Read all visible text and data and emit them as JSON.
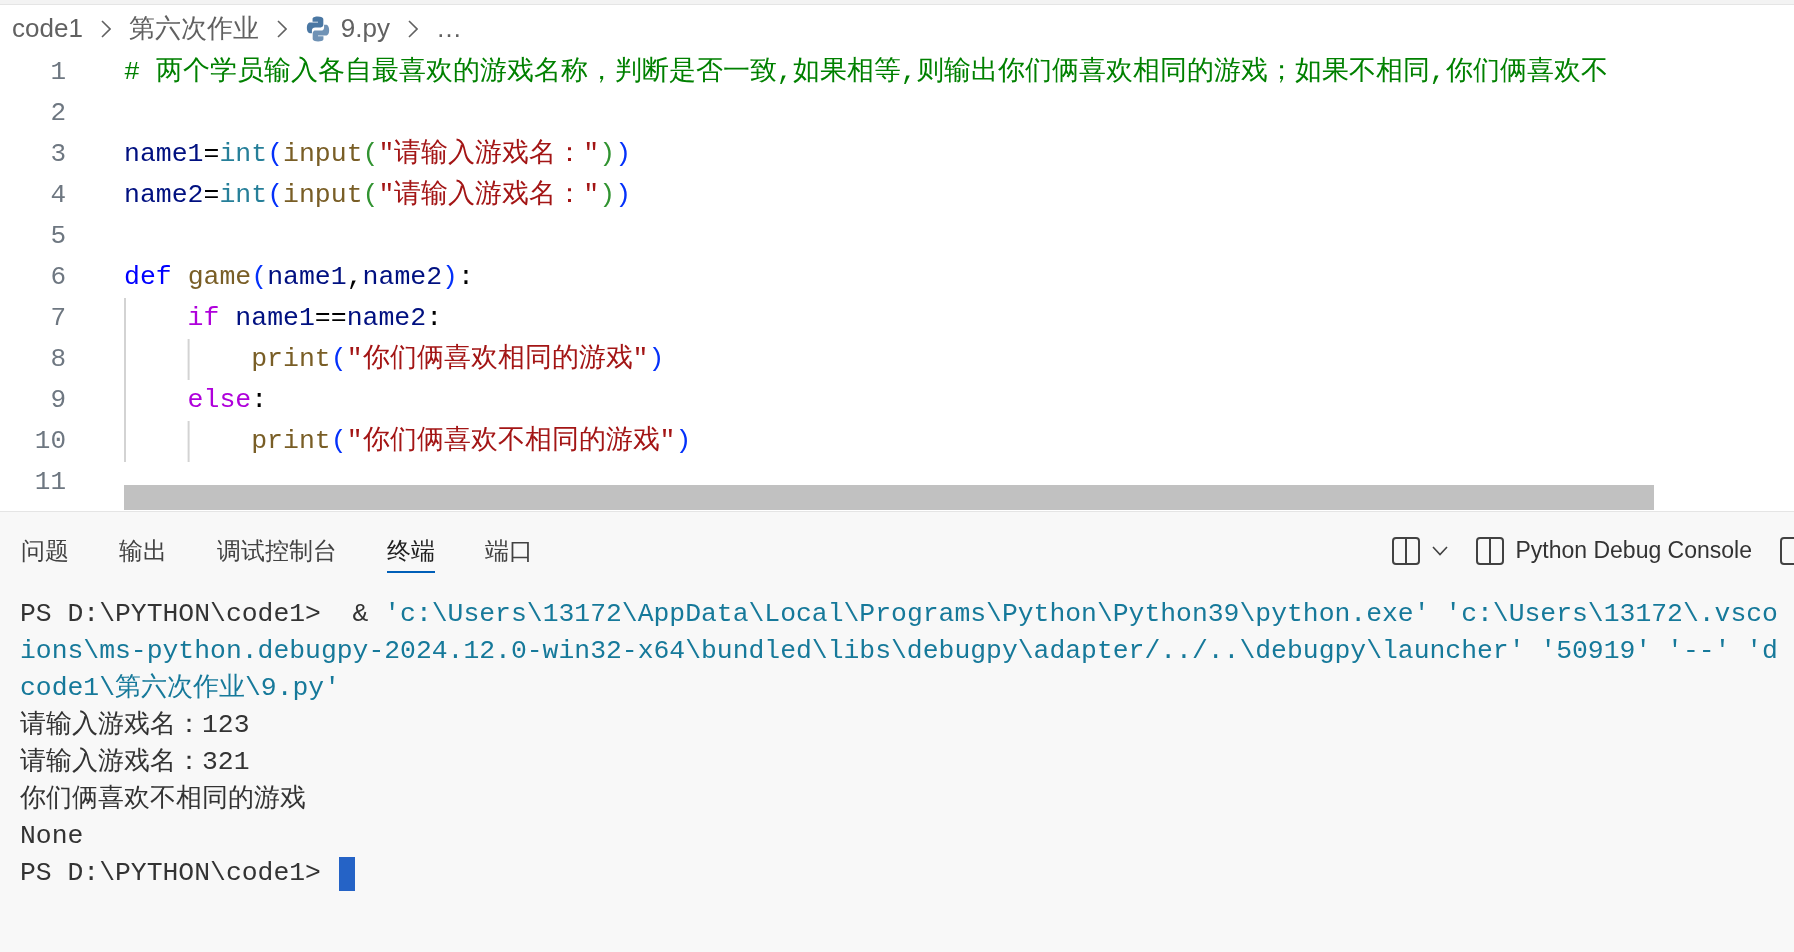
{
  "breadcrumb": {
    "items": [
      {
        "kind": "folder",
        "label": "code1"
      },
      {
        "kind": "folder",
        "label": "第六次作业"
      },
      {
        "kind": "file",
        "label": "9.py"
      },
      {
        "kind": "more",
        "label": "…"
      }
    ]
  },
  "editor": {
    "lines": [
      {
        "number": "1",
        "tokens": [
          {
            "kind": "comment",
            "text": "# 两个学员输入各自最喜欢的游戏名称，判断是否一致,如果相等,则输出你们俩喜欢相同的游戏；如果不相同,你们俩喜欢不"
          }
        ]
      },
      {
        "number": "2"
      },
      {
        "number": "3",
        "tokens": [
          {
            "kind": "variable",
            "text": "name1"
          },
          {
            "kind": "plain",
            "text": "="
          },
          {
            "kind": "type",
            "text": "int"
          },
          {
            "kind": "bracket",
            "text": "("
          },
          {
            "kind": "function",
            "text": "input"
          },
          {
            "kind": "nestedbracket",
            "text": "("
          },
          {
            "kind": "string",
            "text": "\"请输入游戏名：\""
          },
          {
            "kind": "nestedbracket",
            "text": ")"
          },
          {
            "kind": "bracket",
            "text": ")"
          }
        ]
      },
      {
        "number": "4",
        "tokens": [
          {
            "kind": "variable",
            "text": "name2"
          },
          {
            "kind": "plain",
            "text": "="
          },
          {
            "kind": "type",
            "text": "int"
          },
          {
            "kind": "bracket",
            "text": "("
          },
          {
            "kind": "function",
            "text": "input"
          },
          {
            "kind": "nestedbracket",
            "text": "("
          },
          {
            "kind": "string",
            "text": "\"请输入游戏名：\""
          },
          {
            "kind": "nestedbracket",
            "text": ")"
          },
          {
            "kind": "bracket",
            "text": ")"
          }
        ]
      },
      {
        "number": "5"
      },
      {
        "number": "6",
        "tokens": [
          {
            "kind": "keyword",
            "text": "def "
          },
          {
            "kind": "function",
            "text": "game"
          },
          {
            "kind": "bracket",
            "text": "("
          },
          {
            "kind": "variable",
            "text": "name1"
          },
          {
            "kind": "plain",
            "text": ","
          },
          {
            "kind": "variable",
            "text": "name2"
          },
          {
            "kind": "bracket",
            "text": ")"
          },
          {
            "kind": "plain",
            "text": ":"
          }
        ],
        "children": [
          {
            "number": "7",
            "tokens": [
              {
                "kind": "control",
                "text": "if "
              },
              {
                "kind": "variable",
                "text": "name1"
              },
              {
                "kind": "plain",
                "text": "=="
              },
              {
                "kind": "variable",
                "text": "name2"
              },
              {
                "kind": "plain",
                "text": ":"
              }
            ],
            "children": [
              {
                "number": "8",
                "tokens": [
                  {
                    "kind": "function",
                    "text": "print"
                  },
                  {
                    "kind": "bracket",
                    "text": "("
                  },
                  {
                    "kind": "string",
                    "text": "\"你们俩喜欢相同的游戏\""
                  },
                  {
                    "kind": "bracket",
                    "text": ")"
                  }
                ]
              }
            ]
          },
          {
            "number": "9",
            "tokens": [
              {
                "kind": "control",
                "text": "else"
              },
              {
                "kind": "plain",
                "text": ":"
              }
            ],
            "children": [
              {
                "number": "10",
                "tokens": [
                  {
                    "kind": "function",
                    "text": "print"
                  },
                  {
                    "kind": "bracket",
                    "text": "("
                  },
                  {
                    "kind": "string",
                    "text": "\"你们俩喜欢不相同的游戏\""
                  },
                  {
                    "kind": "bracket",
                    "text": ")"
                  }
                ]
              }
            ]
          }
        ]
      },
      {
        "number": "11"
      }
    ]
  },
  "panel": {
    "tabs": [
      {
        "label": "问题",
        "selected": false
      },
      {
        "label": "输出",
        "selected": false
      },
      {
        "label": "调试控制台",
        "selected": false
      },
      {
        "label": "终端",
        "selected": true
      },
      {
        "label": "端口",
        "selected": false
      }
    ],
    "terminal_tab": {
      "label": "Python Debug Console"
    },
    "terminal": {
      "lines": [
        {
          "cursor": false,
          "segments": [
            {
              "kind": "plain",
              "text": "PS D:\\PYTHON\\code1>  & "
            },
            {
              "kind": "string",
              "text": "'c:\\Users\\13172\\AppData\\Local\\Programs\\Python\\Python39\\python.exe' 'c:\\Users\\13172\\.vsco"
            }
          ]
        },
        {
          "cursor": false,
          "segments": [
            {
              "kind": "string",
              "text": "ions\\ms-python.debugpy-2024.12.0-win32-x64\\bundled\\libs\\debugpy\\adapter/../..\\debugpy\\launcher' '50919' '--' 'd"
            }
          ]
        },
        {
          "cursor": false,
          "segments": [
            {
              "kind": "string",
              "text": "code1\\第六次作业\\9.py'"
            }
          ]
        },
        {
          "cursor": false,
          "segments": [
            {
              "kind": "plain",
              "text": "请输入游戏名：123"
            }
          ]
        },
        {
          "cursor": false,
          "segments": [
            {
              "kind": "plain",
              "text": "请输入游戏名：321"
            }
          ]
        },
        {
          "cursor": false,
          "segments": [
            {
              "kind": "plain",
              "text": "你们俩喜欢不相同的游戏"
            }
          ]
        },
        {
          "cursor": false,
          "segments": [
            {
              "kind": "plain",
              "text": "None"
            }
          ]
        },
        {
          "cursor": true,
          "segments": [
            {
              "kind": "plain",
              "text": "PS D:\\PYTHON\\code1>"
            }
          ]
        }
      ]
    }
  }
}
